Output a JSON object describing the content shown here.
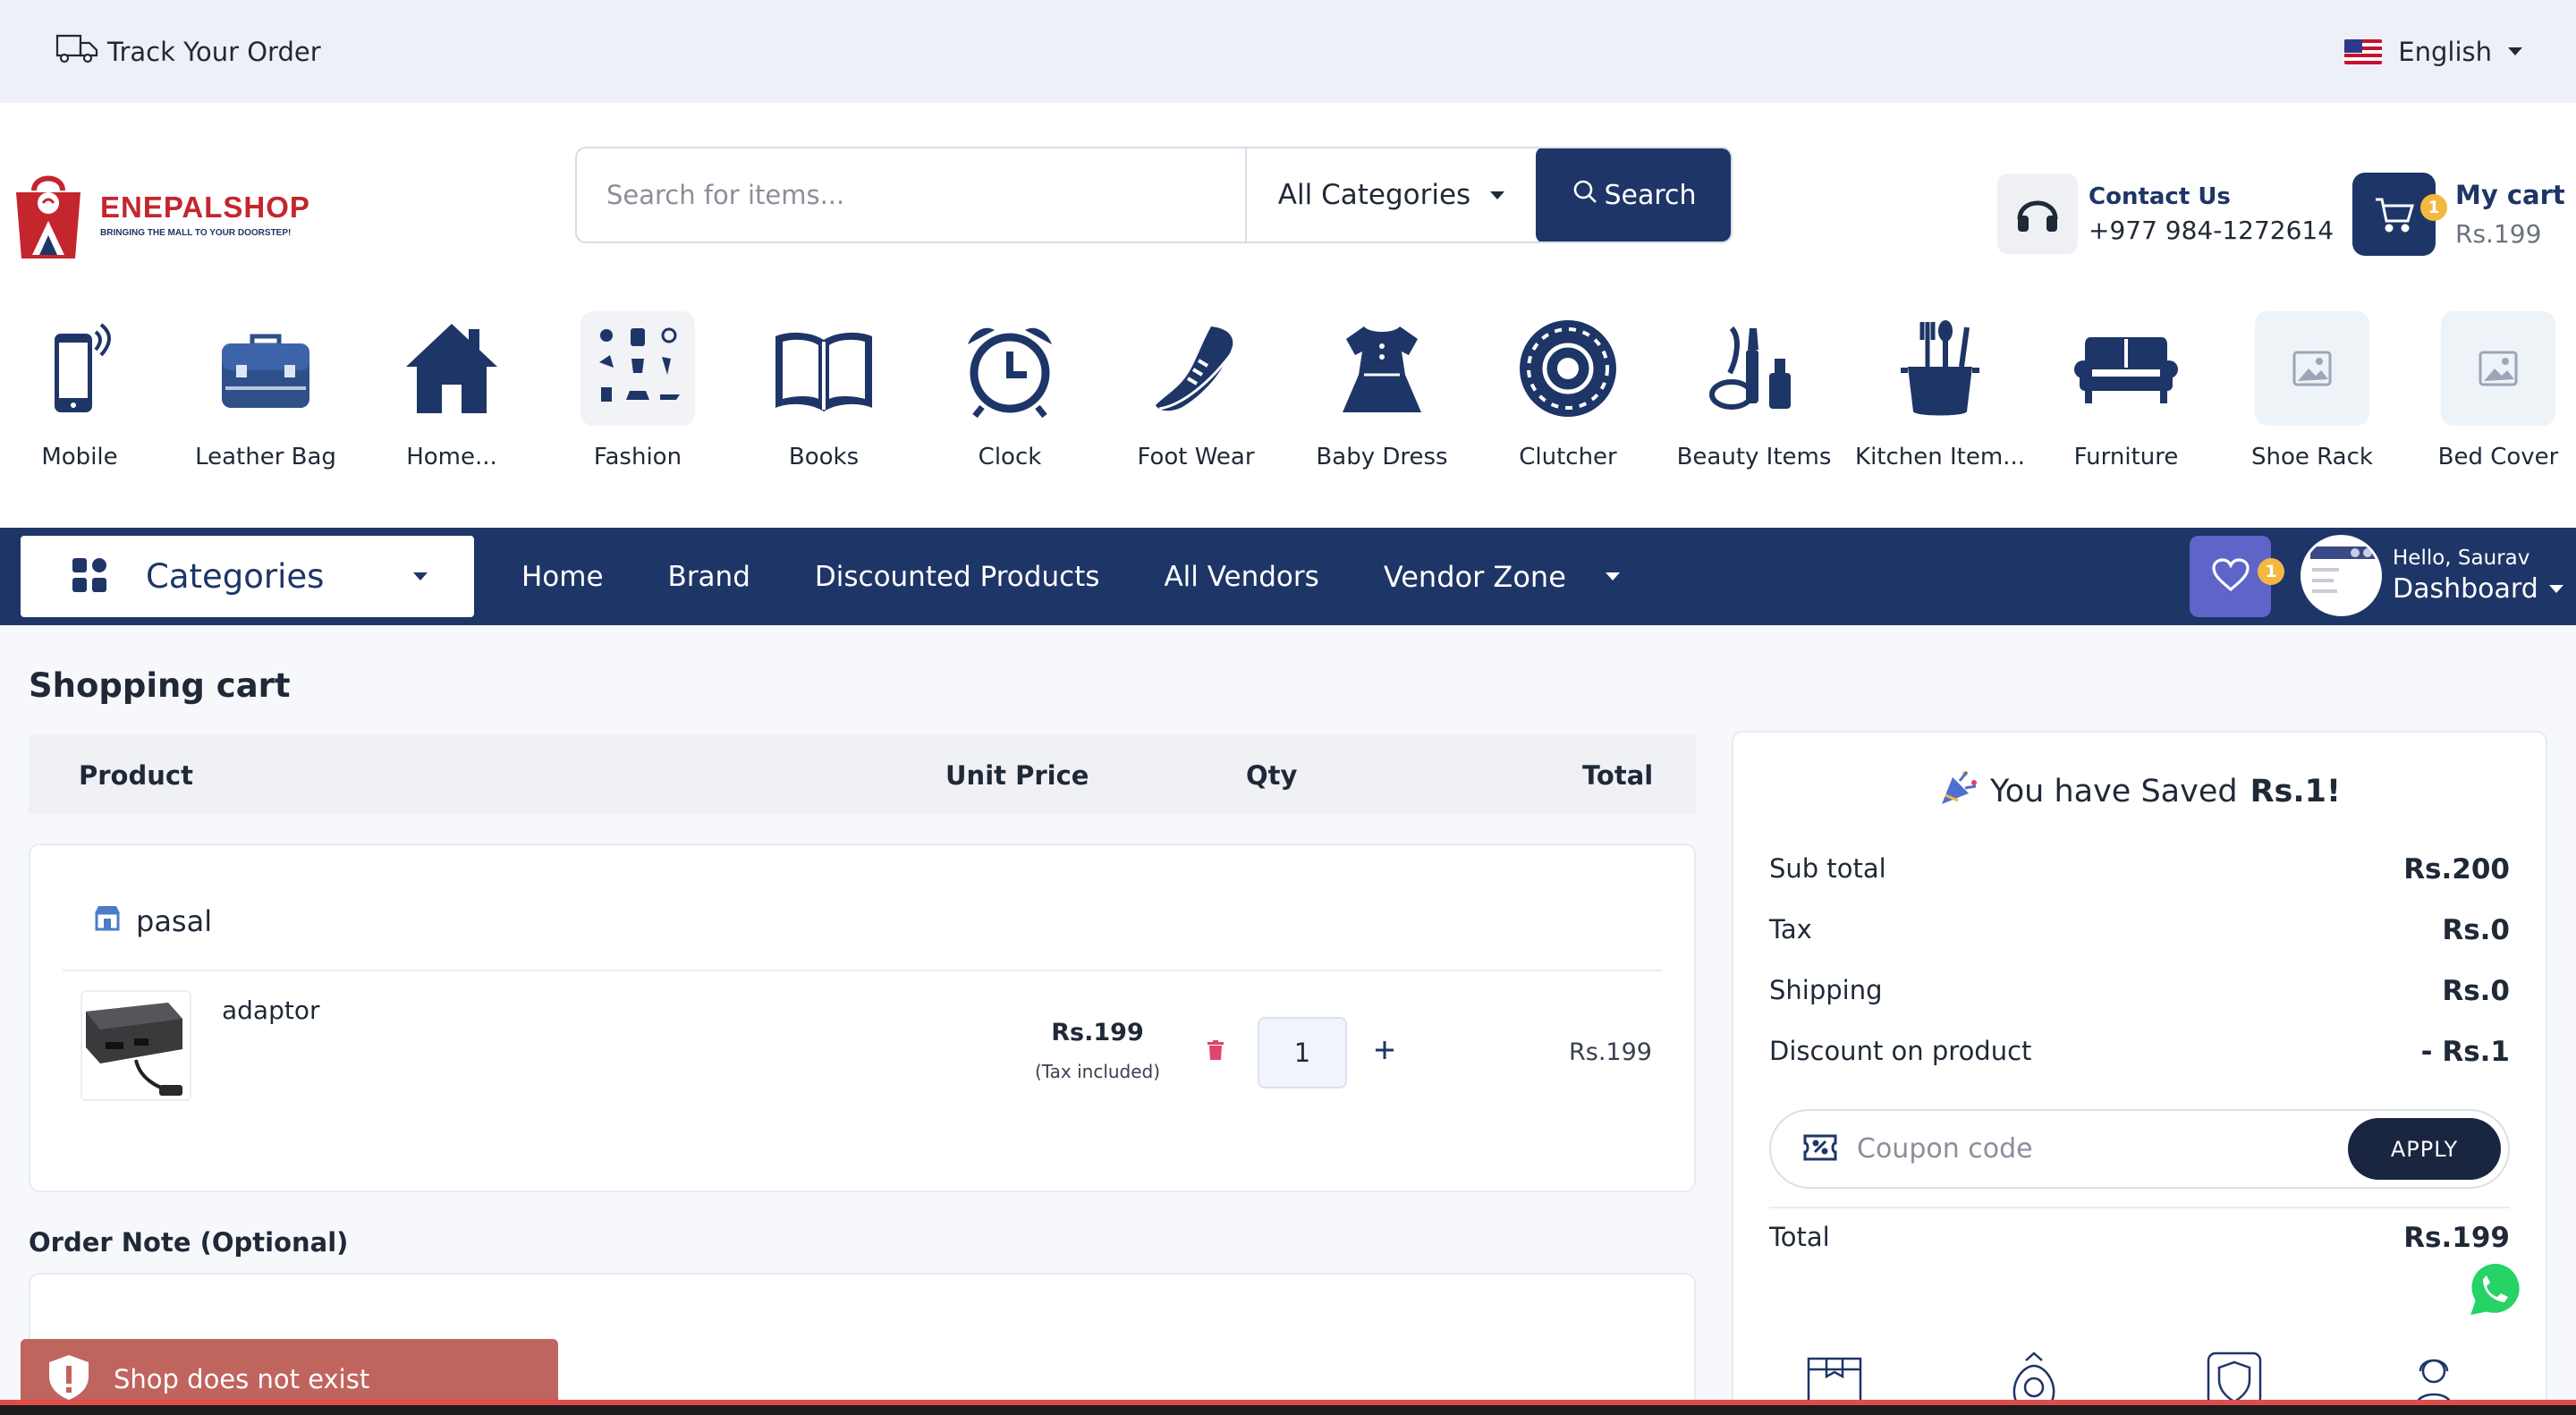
{
  "topbar": {
    "track_label": "Track Your Order",
    "language": "English"
  },
  "brand": {
    "name": "ENEPALSHOP",
    "tagline": "BRINGING THE MALL TO YOUR DOORSTEP!"
  },
  "search": {
    "placeholder": "Search for items...",
    "category": "All Categories",
    "button_label": "Search"
  },
  "contact": {
    "title": "Contact Us",
    "phone": "+977 984-1272614"
  },
  "cart": {
    "title": "My cart",
    "amount": "Rs.199",
    "count": "1"
  },
  "categories": [
    {
      "label": "Mobile",
      "icon": "mobile-icon"
    },
    {
      "label": "Leather Bag",
      "icon": "briefcase-icon"
    },
    {
      "label": "Home...",
      "icon": "home-icon"
    },
    {
      "label": "Fashion",
      "icon": "fashion-icon"
    },
    {
      "label": "Books",
      "icon": "book-icon"
    },
    {
      "label": "Clock",
      "icon": "alarm-clock-icon"
    },
    {
      "label": "Foot Wear",
      "icon": "shoe-icon"
    },
    {
      "label": "Baby Dress",
      "icon": "dress-icon"
    },
    {
      "label": "Clutcher",
      "icon": "clutcher-icon"
    },
    {
      "label": "Beauty Items",
      "icon": "cosmetics-icon"
    },
    {
      "label": "Kitchen Item...",
      "icon": "kitchen-utensils-icon"
    },
    {
      "label": "Furniture",
      "icon": "sofa-icon"
    },
    {
      "label": "Shoe Rack",
      "icon": "image-placeholder-icon"
    },
    {
      "label": "Bed Cover",
      "icon": "image-placeholder-icon"
    }
  ],
  "nav": {
    "categories_label": "Categories",
    "links": [
      "Home",
      "Brand",
      "Discounted Products",
      "All Vendors"
    ],
    "vendor_zone": "Vendor Zone",
    "wishlist_count": "1",
    "greeting": "Hello, Saurav",
    "dashboard": "Dashboard"
  },
  "page": {
    "title": "Shopping cart"
  },
  "table": {
    "headers": {
      "product": "Product",
      "unit_price": "Unit Price",
      "qty": "Qty",
      "total": "Total"
    }
  },
  "shop": {
    "name": "pasal"
  },
  "item": {
    "name": "adaptor",
    "unit_price": "Rs.199",
    "tax_note": "(Tax included)",
    "qty": "1",
    "total": "Rs.199"
  },
  "order_note": {
    "label": "Order Note (Optional)"
  },
  "summary": {
    "saved_prefix": "You have Saved",
    "saved_amount": "Rs.1!",
    "rows": [
      {
        "label": "Sub total",
        "value": "Rs.200"
      },
      {
        "label": "Tax",
        "value": "Rs.0"
      },
      {
        "label": "Shipping",
        "value": "Rs.0"
      },
      {
        "label": "Discount on product",
        "value": "- Rs.1"
      }
    ],
    "coupon_placeholder": "Coupon code",
    "apply_label": "APPLY",
    "total_label": "Total",
    "total_value": "Rs.199"
  },
  "toast": {
    "message": "Shop does not exist"
  },
  "colors": {
    "primary": "#1e3567",
    "accent": "#5f64c9",
    "badge": "#f4b740",
    "danger": "#c0645e",
    "brand_red": "#c4262e"
  }
}
